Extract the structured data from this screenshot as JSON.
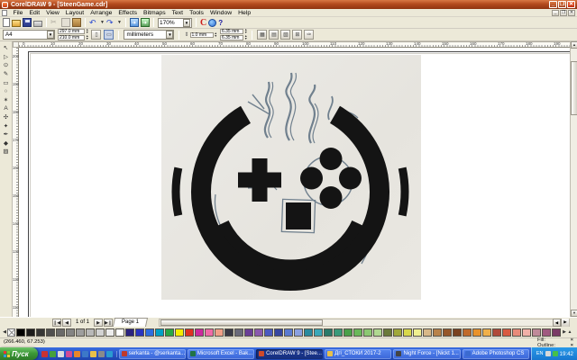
{
  "window": {
    "title": "CorelDRAW 9 - [SteenGame.cdr]",
    "minimize": "_",
    "maximize": "❐",
    "close": "✕"
  },
  "menu": {
    "items": [
      "File",
      "Edit",
      "View",
      "Layout",
      "Arrange",
      "Effects",
      "Bitmaps",
      "Text",
      "Tools",
      "Window",
      "Help"
    ]
  },
  "standard_toolbar": {
    "zoom_level": "170%",
    "undo_glyph": "↶",
    "redo_glyph": "↷",
    "cut_glyph": "✂",
    "corel_c": "C",
    "whats_this": "?"
  },
  "property_bar": {
    "paper_type": "A4",
    "paper_width": "297.0 mm",
    "paper_height": "210.0 mm",
    "portrait_glyph": "▯",
    "landscape_glyph": "▭",
    "units_label": "millimeters",
    "nudge": "1.0 mm",
    "duplicate_x": "6.35 mm",
    "duplicate_y": "6.35 mm",
    "snap_glyphs": [
      "▦",
      "▤",
      "▧",
      "⊞",
      "✑"
    ]
  },
  "rulers": {
    "h_labels": [
      "0",
      "10",
      "20",
      "30",
      "40",
      "50",
      "60",
      "70",
      "80",
      "90",
      "100",
      "110",
      "120",
      "130",
      "140",
      "150",
      "160",
      "170",
      "180",
      "190"
    ],
    "v_labels": [
      "200",
      "190",
      "180",
      "170",
      "160",
      "150",
      "140",
      "130",
      "120",
      "110"
    ]
  },
  "toolbox": {
    "tools": [
      {
        "id": "pick",
        "glyph": "↖"
      },
      {
        "id": "shape",
        "glyph": "▷"
      },
      {
        "id": "zoom",
        "glyph": "⊙"
      },
      {
        "id": "freehand",
        "glyph": "✎"
      },
      {
        "id": "rectangle",
        "glyph": "▭"
      },
      {
        "id": "ellipse",
        "glyph": "○"
      },
      {
        "id": "polygon",
        "glyph": "✶"
      },
      {
        "id": "text",
        "glyph": "A"
      },
      {
        "id": "interactive-blend",
        "glyph": "✣"
      },
      {
        "id": "eyedropper",
        "glyph": "✦"
      },
      {
        "id": "outline",
        "glyph": "✒"
      },
      {
        "id": "fill",
        "glyph": "◆"
      },
      {
        "id": "interactive-fill",
        "glyph": "▨"
      }
    ]
  },
  "artwork": {
    "shapes": [
      "head-ring",
      "left-ear",
      "right-ear",
      "dpad-eye",
      "buttons-eye",
      "square-nose",
      "smile",
      "hair-sketch"
    ],
    "ink_color": "#141414",
    "pencil_color": "#70808e",
    "paper_color": "#e9e7e1"
  },
  "page_controls": {
    "first": "❙◀",
    "prev": "◀",
    "position": "1 of 1",
    "next": "▶",
    "last": "▶❙",
    "tab": "Page 1"
  },
  "palette": {
    "left_arrow": "◀",
    "right_arrow": "▶",
    "up_arrow": "▲",
    "colors": [
      "#000000",
      "#1c1c1c",
      "#363636",
      "#505050",
      "#6a6a6a",
      "#848484",
      "#9e9e9e",
      "#b8b8b8",
      "#d2d2d2",
      "#ececec",
      "#ffffff",
      "#2b2380",
      "#2a35c0",
      "#2e6de0",
      "#00a0c6",
      "#28a746",
      "#f5ec00",
      "#e03122",
      "#cc2a9e",
      "#f06aa8",
      "#f0a088",
      "#3a3a46",
      "#6a6a7a",
      "#6a3f96",
      "#8a5aae",
      "#4a5ac0",
      "#3646a0",
      "#5a7ad0",
      "#8aa0e0",
      "#2a8a9e",
      "#3aa8b8",
      "#2a7a6a",
      "#3a9a7a",
      "#4aa04a",
      "#6ab85a",
      "#8cc872",
      "#b0d890",
      "#6a7a3a",
      "#a0a83a",
      "#d8d84a",
      "#f0f090",
      "#d8b888",
      "#b8824a",
      "#96572a",
      "#7a421f",
      "#c06a2a",
      "#e8922a",
      "#f0b04a",
      "#b04a3a",
      "#d85a42",
      "#e88a7a",
      "#f0b0a8",
      "#c08a9a",
      "#a05a80",
      "#7a3a66"
    ]
  },
  "status_bar": {
    "coords": "(266.460, 67.253)",
    "fill_label": "Fill:",
    "fill_value": "×",
    "outline_label": "Outline:",
    "outline_value": "×"
  },
  "taskbar": {
    "start": "Пуск",
    "quicklaunch": [
      {
        "name": "quicklaunch-1",
        "color": "#c83232"
      },
      {
        "name": "quicklaunch-2",
        "color": "#46a03c"
      },
      {
        "name": "quicklaunch-3",
        "color": "#dcdcdc"
      },
      {
        "name": "quicklaunch-yahoo",
        "color": "#d04a96"
      },
      {
        "name": "quicklaunch-5",
        "color": "#e8862a"
      },
      {
        "name": "quicklaunch-6",
        "color": "#3c78c8"
      },
      {
        "name": "quicklaunch-folder",
        "color": "#e8c04a"
      },
      {
        "name": "quicklaunch-8",
        "color": "#8a8a8a"
      },
      {
        "name": "quicklaunch-9",
        "color": "#2a9ad0"
      }
    ],
    "buttons": [
      {
        "label": "serkanta - @serkanta...",
        "icon_color": "#c0392b",
        "active": false
      },
      {
        "label": "Microsoft Excel - Bak...",
        "icon_color": "#217346",
        "active": false
      },
      {
        "label": "CorelDRAW 9 - [Stee...",
        "icon_color": "#d04a2a",
        "active": true
      },
      {
        "label": "Дгі_СТОКИ 2017-2",
        "icon_color": "#e8c04a",
        "active": false
      },
      {
        "label": "Night Force - [Nickt 1...",
        "icon_color": "#444444",
        "active": false
      },
      {
        "label": "Adobe Photoshop CS",
        "icon_color": "#3a6ad0",
        "active": false
      }
    ],
    "tray": {
      "lang": "EN",
      "clock": "19:42"
    }
  }
}
